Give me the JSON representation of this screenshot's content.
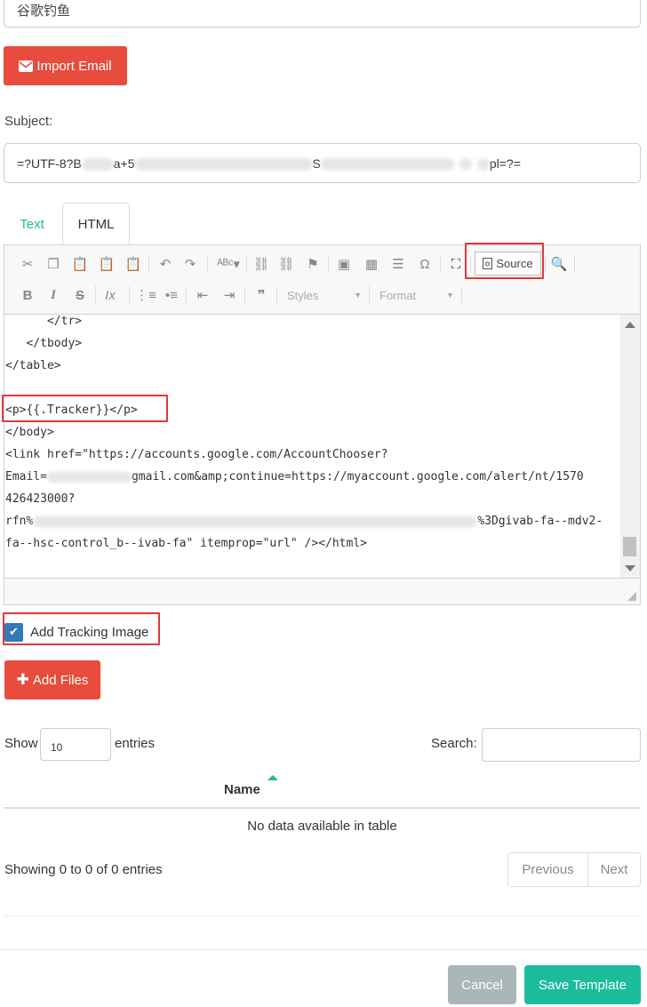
{
  "sender": {
    "name_value": "谷歌钓鱼"
  },
  "import_button": {
    "label": "Import Email",
    "icon": "envelope-icon"
  },
  "subject": {
    "label": "Subject:",
    "value_start": "=?UTF-8?B",
    "value_mid": "a+5",
    "value_mid2": "S",
    "value_end": "pl=?="
  },
  "tabs": [
    {
      "label": "Text"
    },
    {
      "label": "HTML"
    }
  ],
  "editor": {
    "toolbar": {
      "source_label": "Source",
      "styles_label": "Styles",
      "format_label": "Format"
    },
    "code_lines": [
      "      </tr>",
      "   </tbody>",
      "</table>",
      "",
      "<p>{{.Tracker}}</p>",
      "</body>",
      "<link href=\"https://accounts.google.com/AccountChooser?",
      "gmail.com&amp;continue=https://myaccount.google.com/alert/nt/1570",
      "426423000?",
      "%3Dgivab-fa--mdv2-",
      "fa--hsc-control_b--ivab-fa\" itemprop=\"url\" /></html>"
    ],
    "email_prefix": "Email=",
    "rfn_prefix": "rfn%"
  },
  "tracking": {
    "label": "Add Tracking Image",
    "checked": true
  },
  "add_files_button": {
    "label": "Add Files"
  },
  "table": {
    "show_label": "Show",
    "page_length": "10",
    "entries_label": "entries",
    "search_label": "Search:",
    "columns": [
      {
        "label": "Name"
      }
    ],
    "empty_message": "No data available in table",
    "info": "Showing 0 to 0 of 0 entries",
    "previous_label": "Previous",
    "next_label": "Next"
  },
  "footer": {
    "cancel_label": "Cancel",
    "save_label": "Save Template"
  },
  "colors": {
    "red": "#e74c3c",
    "teal": "#1abc9c",
    "highlight": "#e03a3a",
    "check_blue": "#337ab7"
  }
}
